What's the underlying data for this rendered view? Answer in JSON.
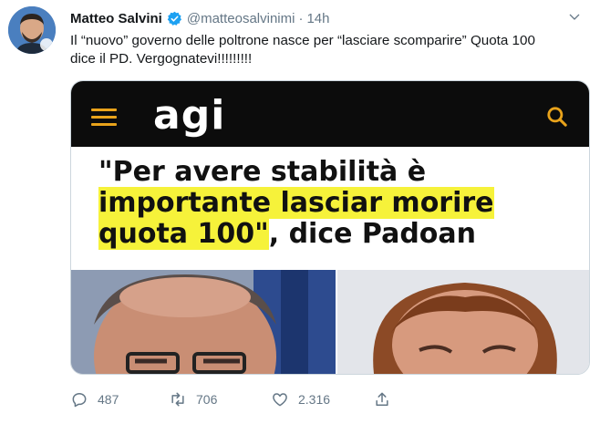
{
  "author": {
    "name": "Matteo Salvini",
    "handle": "@matteosalvinimi",
    "separator": "·",
    "time": "14h"
  },
  "tweet": {
    "text_line1": "Il “nuovo” governo delle poltrone nasce per “lasciare scomparire” Quota 100",
    "text_line2": "dice il PD. Vergognatevi!!!!!!!!!"
  },
  "card": {
    "logo": "agi",
    "headline_line1": "\"Per avere stabilità è",
    "headline_hl2": "importante lasciar morire",
    "headline_hl3": "quota 100\"",
    "headline_rest3": ", dice Padoan"
  },
  "actions": {
    "replies": "487",
    "retweets": "706",
    "likes": "2.316"
  },
  "colors": {
    "accent": "#1da1f2",
    "muted": "#657786",
    "highlight": "#f6f23a",
    "agi_orange": "#e9a31b"
  }
}
